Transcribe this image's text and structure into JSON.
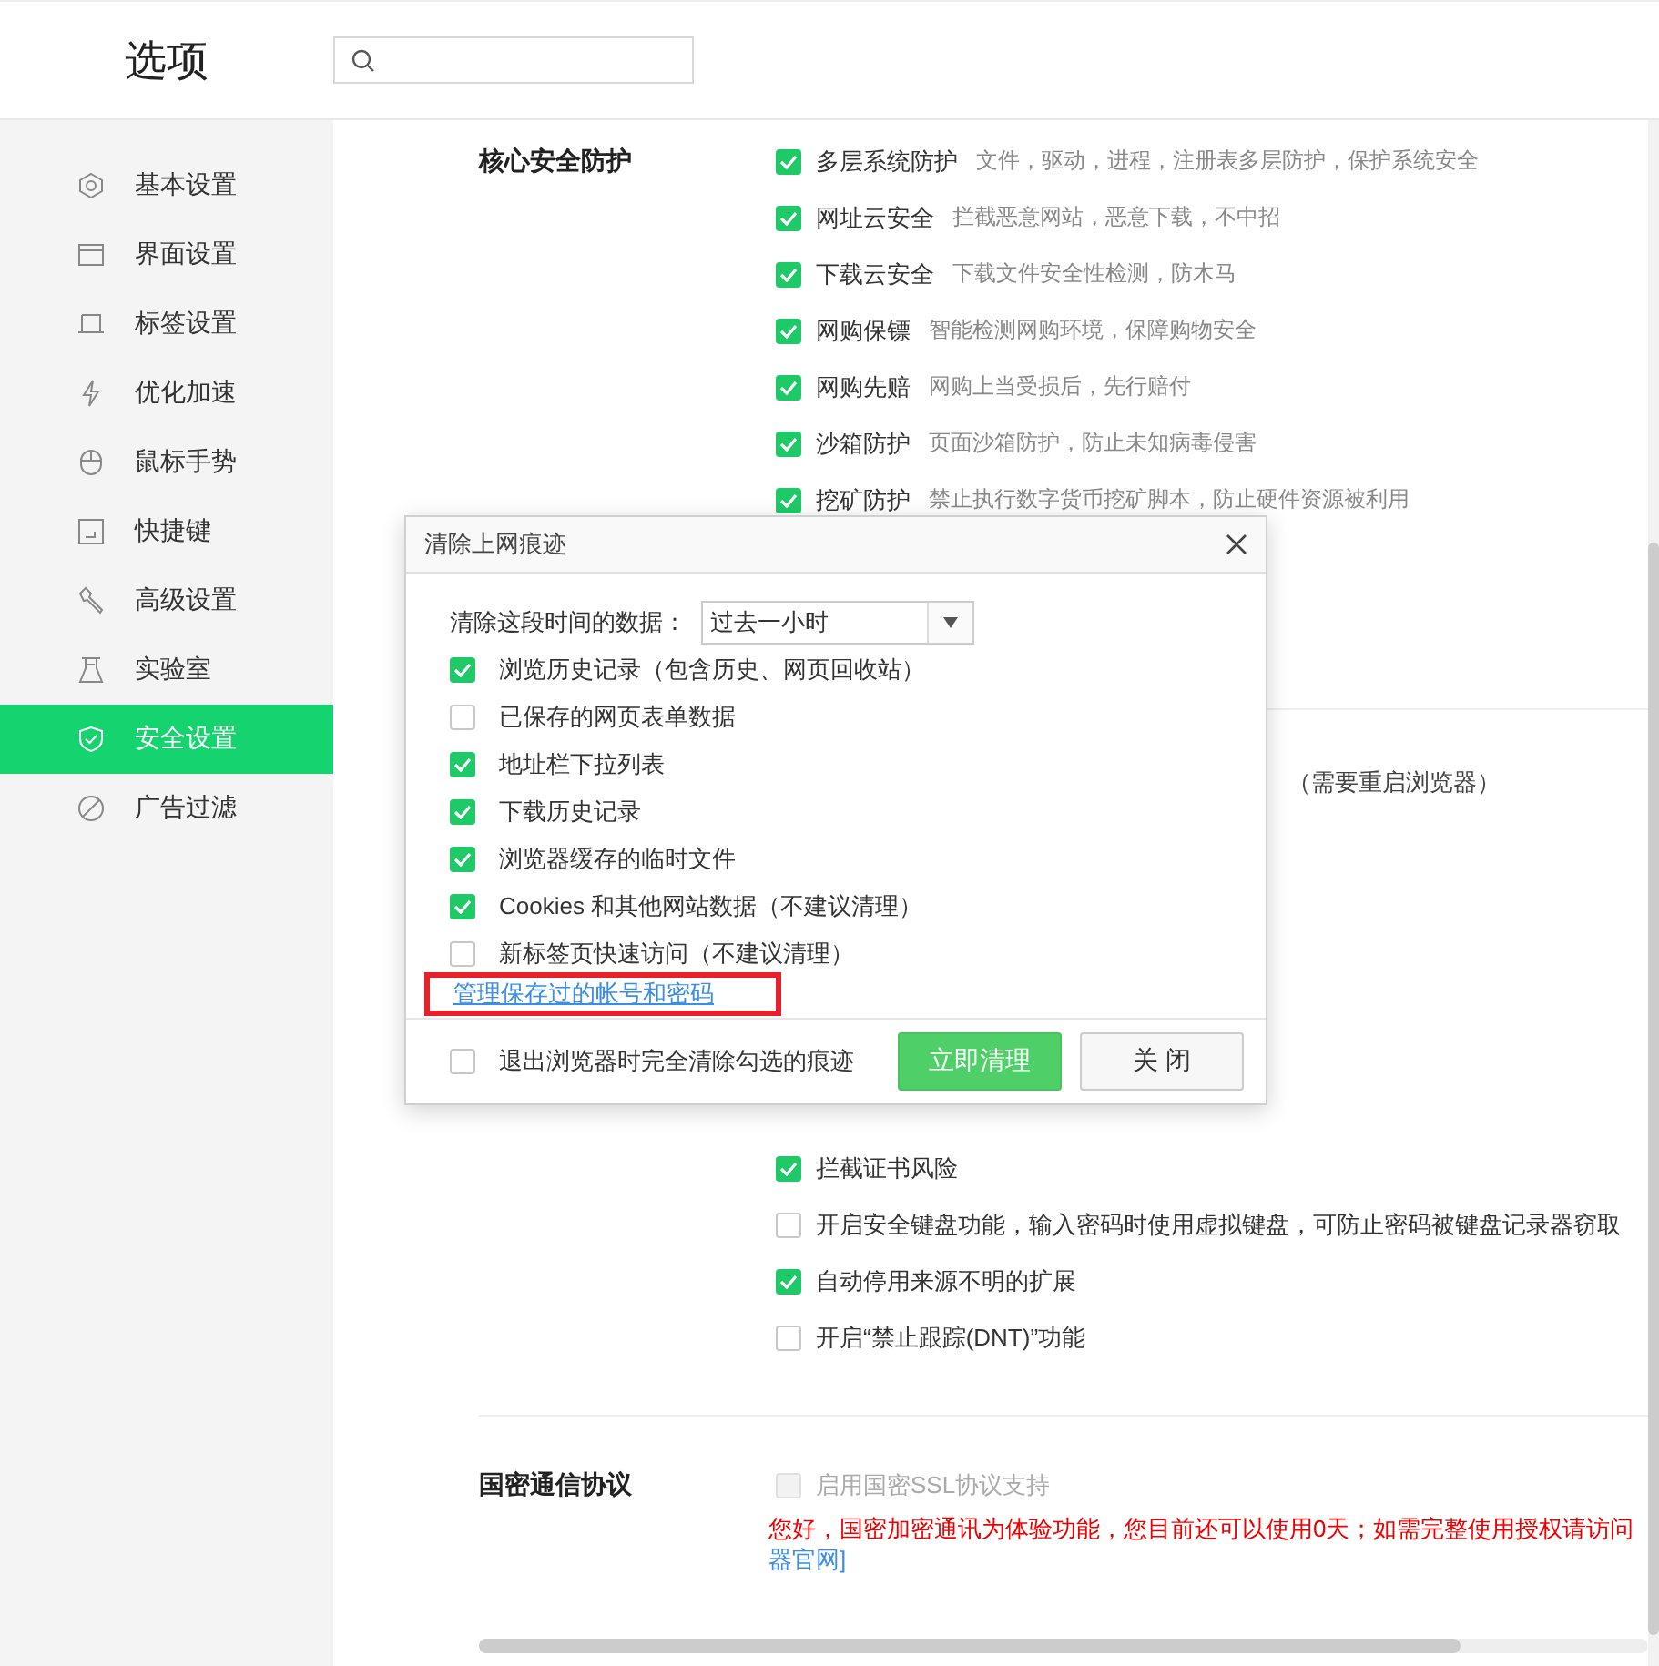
{
  "header": {
    "title": "选项"
  },
  "sidebar": {
    "items": [
      {
        "label": "基本设置",
        "selected": false
      },
      {
        "label": "界面设置",
        "selected": false
      },
      {
        "label": "标签设置",
        "selected": false
      },
      {
        "label": "优化加速",
        "selected": false
      },
      {
        "label": "鼠标手势",
        "selected": false
      },
      {
        "label": "快捷键",
        "selected": false
      },
      {
        "label": "高级设置",
        "selected": false
      },
      {
        "label": "实验室",
        "selected": false
      },
      {
        "label": "安全设置",
        "selected": true
      },
      {
        "label": "广告过滤",
        "selected": false
      }
    ]
  },
  "core_protection": {
    "title": "核心安全防护",
    "options": [
      {
        "label": "多层系统防护",
        "description": "文件，驱动，进程，注册表多层防护，保护系统安全",
        "checked": true
      },
      {
        "label": "网址云安全",
        "description": "拦截恶意网站，恶意下载，不中招",
        "checked": true
      },
      {
        "label": "下载云安全",
        "description": "下载文件安全性检测，防木马",
        "checked": true
      },
      {
        "label": "网购保镖",
        "description": "智能检测网购环境，保障购物安全",
        "checked": true
      },
      {
        "label": "网购先赔",
        "description": "网购上当受损后，先行赔付",
        "checked": true
      },
      {
        "label": "沙箱防护",
        "description": "页面沙箱防护，防止未知病毒侵害",
        "checked": true
      },
      {
        "label": "挖矿防护",
        "description": "禁止执行数字货币挖矿脚本，防止硬件资源被利用",
        "checked": true
      }
    ]
  },
  "security_options": {
    "note": "（需要重启浏览器）",
    "options": [
      {
        "label": "拦截证书风险",
        "checked": true
      },
      {
        "label": "开启安全键盘功能，输入密码时使用虚拟键盘，可防止密码被键盘记录器窃取",
        "checked": false
      },
      {
        "label": "自动停用来源不明的扩展",
        "checked": true
      },
      {
        "label": "开启“禁止跟踪(DNT)”功能",
        "checked": false
      }
    ]
  },
  "national_crypto": {
    "title": "国密通信协议",
    "options": [
      {
        "label": "启用国密SSL协议支持",
        "checked": false,
        "disabled": true
      }
    ],
    "notice": "您好，国密加密通讯为体验功能，您目前还可以使用0天；如需完整使用授权请访问",
    "link": "器官网]"
  },
  "dialog": {
    "title": "清除上网痕迹",
    "range_label": "清除这段时间的数据：",
    "range_value": "过去一小时",
    "options": [
      {
        "label": "浏览历史记录（包含历史、网页回收站）",
        "checked": true
      },
      {
        "label": "已保存的网页表单数据",
        "checked": false
      },
      {
        "label": "地址栏下拉列表",
        "checked": true
      },
      {
        "label": "下载历史记录",
        "checked": true
      },
      {
        "label": "浏览器缓存的临时文件",
        "checked": true
      },
      {
        "label": "Cookies 和其他网站数据（不建议清理）",
        "checked": true
      },
      {
        "label": "新标签页快速访问（不建议清理）",
        "checked": false
      }
    ],
    "link": "管理保存过的帐号和密码",
    "link_highlighted": true,
    "exit_option": {
      "label": "退出浏览器时完全清除勾选的痕迹",
      "checked": false
    },
    "buttons": [
      "立即清理",
      "关 闭"
    ]
  }
}
